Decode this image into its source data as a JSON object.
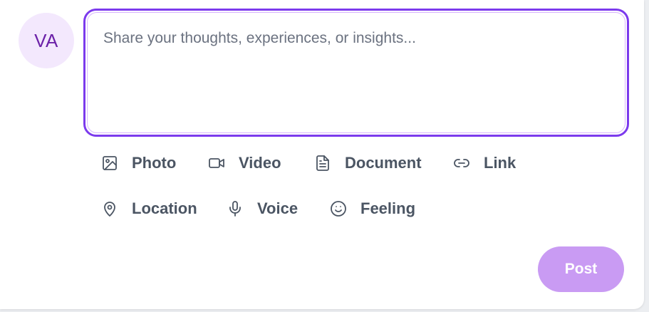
{
  "user": {
    "avatar_initials": "VA"
  },
  "composer": {
    "placeholder": "Share your thoughts, experiences, or insights...",
    "value": ""
  },
  "actions": [
    {
      "label": "Photo",
      "icon": "image-icon"
    },
    {
      "label": "Video",
      "icon": "video-camera-icon"
    },
    {
      "label": "Document",
      "icon": "document-icon"
    },
    {
      "label": "Link",
      "icon": "link-icon"
    },
    {
      "label": "Location",
      "icon": "map-pin-icon"
    },
    {
      "label": "Voice",
      "icon": "microphone-icon"
    },
    {
      "label": "Feeling",
      "icon": "smiley-icon"
    }
  ],
  "post_button": {
    "label": "Post",
    "state": "disabled"
  },
  "colors": {
    "accent": "#7c3aed",
    "avatar_bg": "#f3e8fd",
    "avatar_text": "#6b21a8",
    "post_button_bg": "#c99bf3",
    "icon_text": "#4b5563"
  }
}
